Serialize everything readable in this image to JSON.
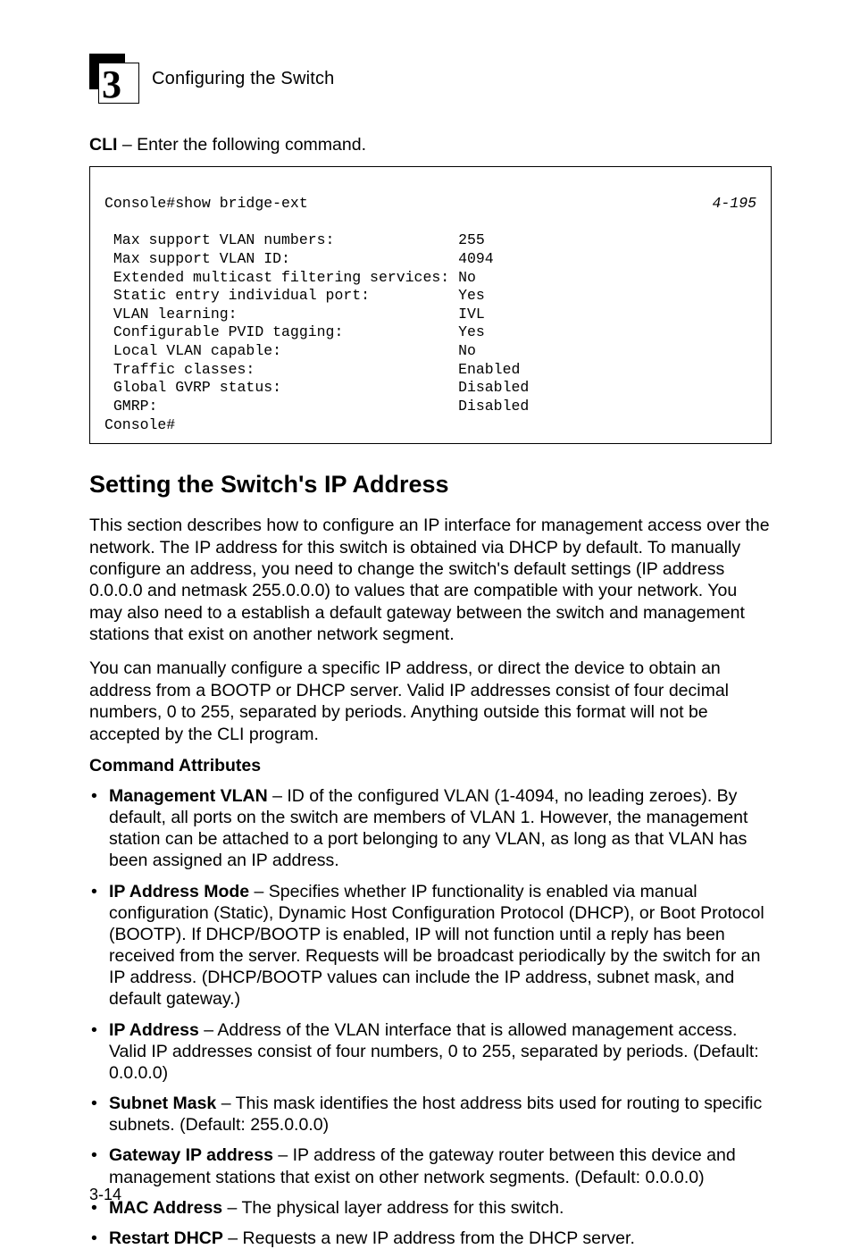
{
  "header": {
    "chapter_number": "3",
    "section_title": "Configuring the Switch"
  },
  "intro_line": {
    "bold": "CLI",
    "rest": " – Enter the following command."
  },
  "cli": {
    "ref": "4-195",
    "lines": [
      "Console#show bridge-ext",
      " Max support VLAN numbers:              255",
      " Max support VLAN ID:                   4094",
      " Extended multicast filtering services: No",
      " Static entry individual port:          Yes",
      " VLAN learning:                         IVL",
      " Configurable PVID tagging:             Yes",
      " Local VLAN capable:                    No",
      " Traffic classes:                       Enabled",
      " Global GVRP status:                    Disabled",
      " GMRP:                                  Disabled",
      "Console#"
    ]
  },
  "section_heading": "Setting the Switch's IP Address",
  "para1": "This section describes how to configure an IP interface for management access over the network. The IP address for this switch is obtained via DHCP by default. To manually configure an address, you need to change the switch's default settings (IP address 0.0.0.0 and netmask 255.0.0.0) to values that are compatible with your network. You may also need to a establish a default gateway between the switch and management stations that exist on another network segment.",
  "para2": "You can manually configure a specific IP address, or direct the device to obtain an address from a BOOTP or DHCP server. Valid IP addresses consist of four decimal numbers, 0 to 255, separated by periods. Anything outside this format will not be accepted by the CLI program.",
  "cmd_attr_heading": "Command Attributes",
  "bullets": [
    {
      "bold": "Management VLAN",
      "text": " – ID of the configured VLAN (1-4094, no leading zeroes). By default, all ports on the switch are members of VLAN 1. However, the management station can be attached to a port belonging to any VLAN, as long as that VLAN has been assigned an IP address."
    },
    {
      "bold": "IP Address Mode",
      "text": " – Specifies whether IP functionality is enabled via manual configuration (Static), Dynamic Host Configuration Protocol (DHCP), or Boot Protocol (BOOTP). If DHCP/BOOTP is enabled, IP will not function until a reply has been received from the server. Requests will be broadcast periodically by the switch for an IP address. (DHCP/BOOTP values can include the IP address, subnet mask, and default gateway.)"
    },
    {
      "bold": "IP Address",
      "text": " – Address of the VLAN interface that is allowed management access. Valid IP addresses consist of four numbers, 0 to 255, separated by periods. (Default: 0.0.0.0)"
    },
    {
      "bold": "Subnet Mask",
      "text": " – This mask identifies the host address bits used for routing to specific subnets. (Default: 255.0.0.0)"
    },
    {
      "bold": "Gateway IP address",
      "text": " – IP address of the gateway router between this device and management stations that exist on other network segments. (Default: 0.0.0.0)"
    },
    {
      "bold": "MAC Address",
      "text": " – The physical layer address for this switch."
    },
    {
      "bold": "Restart DHCP",
      "text": " – Requests a new IP address from the DHCP server."
    }
  ],
  "page_number": "3-14"
}
